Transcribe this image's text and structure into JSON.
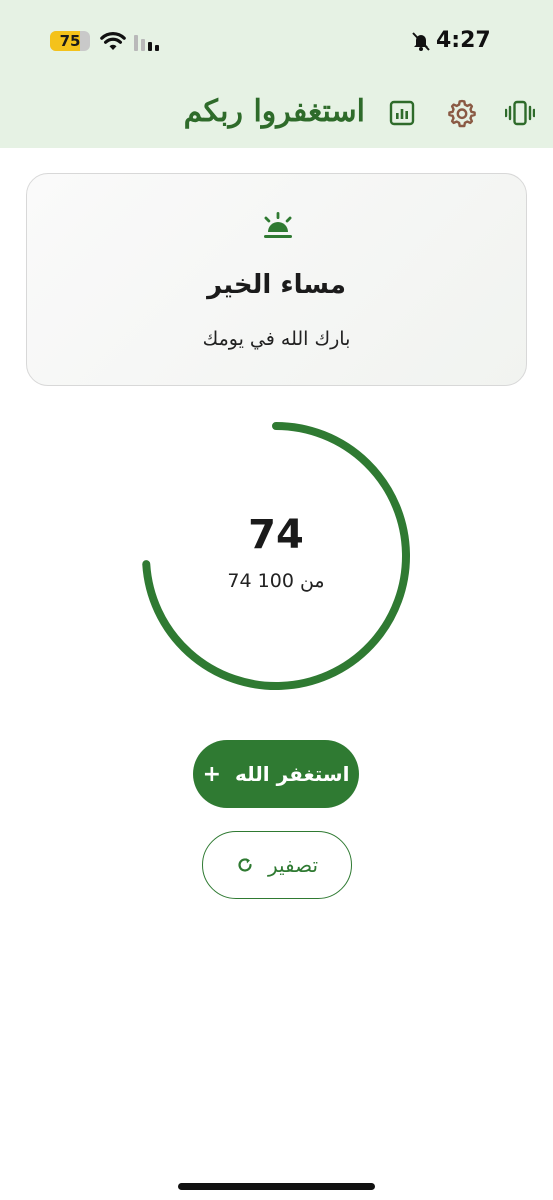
{
  "status_bar": {
    "battery_level": "75",
    "battery_fraction": 0.75,
    "battery_color": "#f4c21b",
    "time": "4:27",
    "icons": [
      "battery-icon",
      "wifi-icon",
      "cellular-signal-icon",
      "silent-mode-icon"
    ]
  },
  "app_bar": {
    "title": "استغفروا ربكم",
    "actions": [
      "stats-icon",
      "settings-gear-icon",
      "vibration-icon"
    ]
  },
  "greeting": {
    "icon": "sunset-icon",
    "title": "مساء الخير",
    "subtitle": "بارك الله في يومك"
  },
  "counter": {
    "count": "74",
    "of_label": "من 100 74",
    "progress_fraction": 0.74
  },
  "buttons": {
    "primary_label": "استغفر الله",
    "primary_symbol": "+",
    "reset_label": "تصفير"
  },
  "colors": {
    "accent": "#2f7a32",
    "title_green": "#2e6b2a",
    "header_bg": "#e6f2e4",
    "settings_icon": "#8a5a44"
  }
}
